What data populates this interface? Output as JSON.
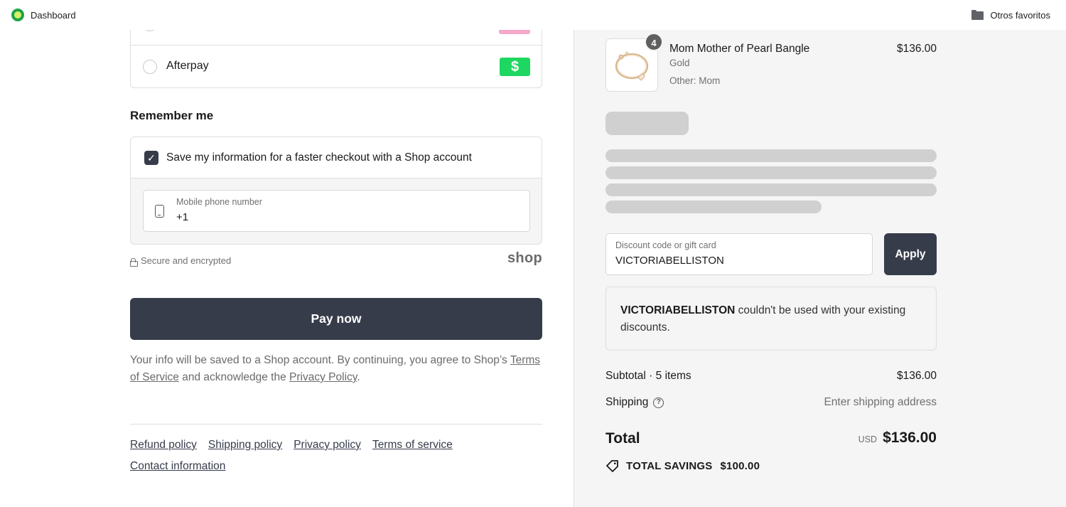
{
  "bookmarks": {
    "left_label": "Dashboard",
    "right_label": "Otros favoritos"
  },
  "payment_methods": {
    "afterpay_label": "Afterpay",
    "afterpay_badge": "$"
  },
  "remember_me": {
    "title": "Remember me",
    "save_info_label": "Save my information for a faster checkout with a Shop account",
    "save_info_checked": true,
    "phone_placeholder": "Mobile phone number",
    "phone_value": "+1"
  },
  "security": {
    "secure_text": "Secure and encrypted",
    "shop_logo": "shop"
  },
  "pay_button_label": "Pay now",
  "legal": {
    "text_before": "Your info will be saved to a Shop account. By continuing, you agree to Shop’s ",
    "terms_link": "Terms of Service",
    "text_middle": " and acknowledge the ",
    "privacy_link": "Privacy Policy",
    "text_after": "."
  },
  "footer_links": {
    "refund": "Refund policy",
    "shipping": "Shipping policy",
    "privacy": "Privacy policy",
    "terms": "Terms of service",
    "contact": "Contact information"
  },
  "order_item": {
    "quantity": "4",
    "name": "Mom Mother of Pearl Bangle",
    "variant": "Gold",
    "other": "Other: Mom",
    "price": "$136.00"
  },
  "discount": {
    "placeholder": "Discount code or gift card",
    "value": "VICTORIABELLISTON",
    "apply_label": "Apply",
    "error_code": "VICTORIABELLISTON",
    "error_message": " couldn't be used with your existing discounts."
  },
  "totals": {
    "subtotal_label": "Subtotal · 5 items",
    "subtotal_value": "$136.00",
    "shipping_label": "Shipping",
    "shipping_value": "Enter shipping address",
    "total_label": "Total",
    "currency": "USD",
    "total_value": "$136.00",
    "savings_label": "TOTAL SAVINGS",
    "savings_value": "$100.00"
  },
  "colors": {
    "primary_button": "#363c4a",
    "afterpay_green": "#1ed760",
    "summary_bg": "#f5f5f5"
  }
}
